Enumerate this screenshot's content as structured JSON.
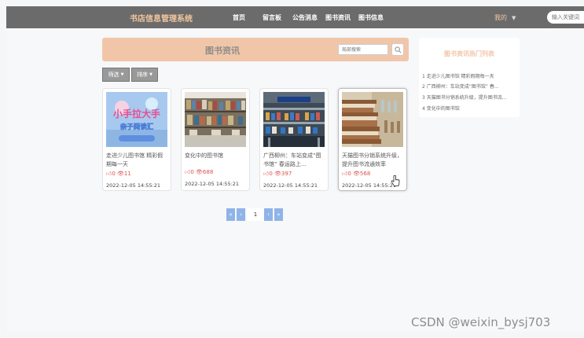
{
  "header": {
    "brand": "书店信息管理系统",
    "nav": [
      "首页",
      "留言板",
      "公告消息",
      "图书资讯",
      "图书信息"
    ],
    "mine": "我的",
    "search_placeholder": "输入关键词"
  },
  "main": {
    "title": "图书资讯",
    "search_placeholder": "局部搜索",
    "filter_label": "筛选",
    "sort_label": "排序",
    "cards": [
      {
        "title": "走进少儿图书馆 精彩假期每一天",
        "likes": "0",
        "views": "11",
        "date": "2022-12-05 14:55:21"
      },
      {
        "title": "变化中的图书馆",
        "likes": "0",
        "views": "688",
        "date": "2022-12-05 14:55:21"
      },
      {
        "title": "广西柳州：车站变成“图书馆” 春运路上…",
        "likes": "0",
        "views": "397",
        "date": "2022-12-05 14:55:21"
      },
      {
        "title": "天猫图书分销系统升级，提升图书流通效率",
        "likes": "0",
        "views": "568",
        "date": "2022-12-05 14:55:21"
      }
    ],
    "thumb_text": {
      "poster_line1": "小手拉大手",
      "poster_line2": "亲子阅读汇"
    },
    "pager": {
      "first": "«",
      "prev": "‹",
      "current": "1",
      "next": "›",
      "last": "»"
    }
  },
  "hot": {
    "title": "图书资讯热门列表",
    "items": [
      "1 走进少儿图书馆 精彩假期每一天",
      "2 广西柳州：车站变成“图书馆” 春...",
      "3 天猫图书分销系统升级，提升图书流...",
      "4 变化中的图书馆"
    ]
  },
  "watermark": "CSDN @weixin_bysj703",
  "colors": {
    "topbar": "#6b6b6b",
    "accent": "#f1c6a8",
    "brand": "#f2c69f",
    "pager": "#8fb4e8",
    "stats": "#d9534f"
  }
}
